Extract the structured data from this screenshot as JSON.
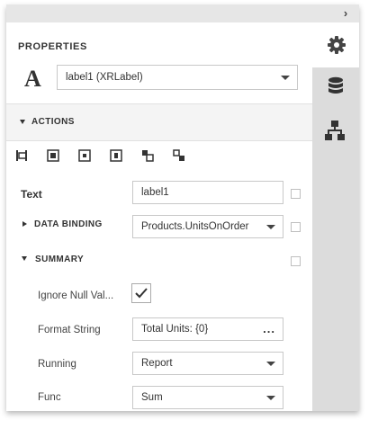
{
  "panel": {
    "title": "PROPERTIES",
    "collapse_icon": "chevron-right-icon",
    "control_icon_letter": "A",
    "selected_control": "label1 (XRLabel)"
  },
  "side_tabs": [
    {
      "name": "properties",
      "icon": "gear-icon"
    },
    {
      "name": "field-list",
      "icon": "database-icon"
    },
    {
      "name": "report-explorer",
      "icon": "hierarchy-icon"
    }
  ],
  "actions": {
    "label": "ACTIONS",
    "toolbar_icons": [
      "align-left-icon",
      "align-center-icon",
      "align-middle-icon",
      "align-right-icon",
      "bring-to-front-icon",
      "send-to-back-icon"
    ]
  },
  "text_row": {
    "label": "Text",
    "value": "label1"
  },
  "data_binding": {
    "label": "DATA BINDING",
    "value": "Products.UnitsOnOrder"
  },
  "summary": {
    "label": "SUMMARY",
    "ignore_null_values": {
      "label": "Ignore Null Val...",
      "checked": true
    },
    "format_string": {
      "label": "Format String",
      "value": "Total Units: {0}",
      "button": "..."
    },
    "running": {
      "label": "Running",
      "value": "Report"
    },
    "func": {
      "label": "Func",
      "value": "Sum"
    }
  },
  "colors": {
    "accent_bg": "#dcdcdc",
    "band": "#f4f4f4",
    "topbar": "#e6e6e6"
  }
}
